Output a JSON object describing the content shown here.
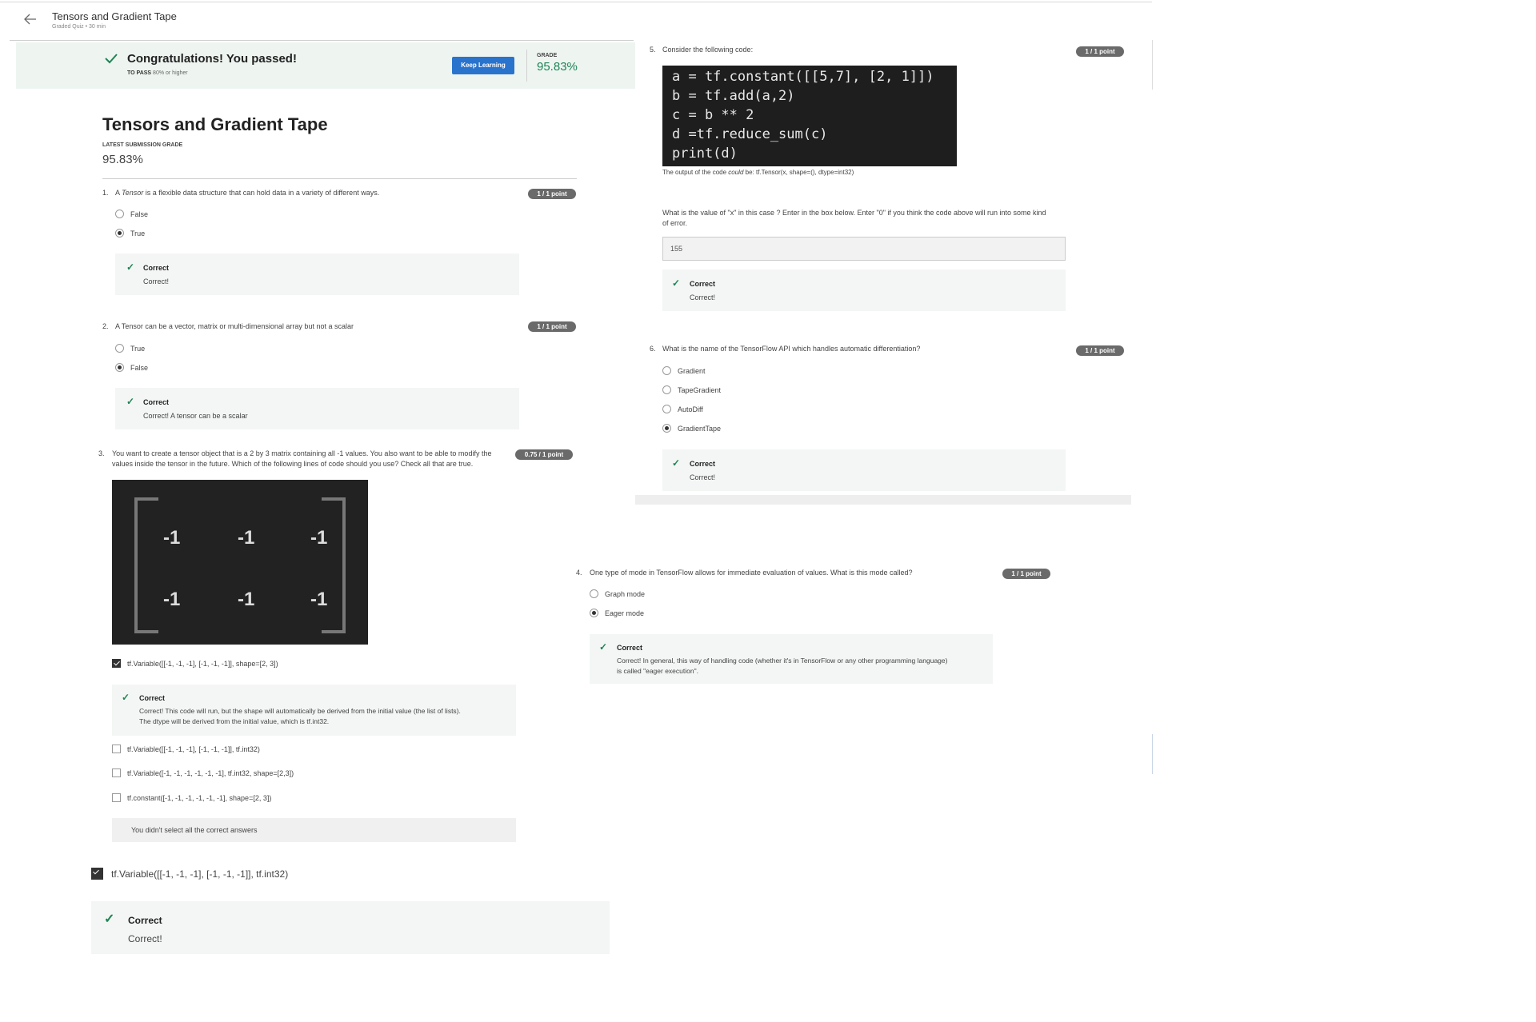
{
  "header": {
    "title": "Tensors and Gradient Tape",
    "subtitle": "Graded Quiz • 30 min"
  },
  "banner": {
    "message": "Congratulations! You passed!",
    "to_pass_label": "TO PASS",
    "to_pass_value": "80% or higher",
    "button": "Keep Learning",
    "grade_label": "GRADE",
    "grade_value": "95.83%"
  },
  "quiz": {
    "title": "Tensors and Gradient Tape",
    "latest_label": "LATEST SUBMISSION GRADE",
    "latest_value": "95.83%"
  },
  "q1": {
    "num": "1.",
    "text_pre": "A ",
    "text_em": "Tensor",
    "text_post": " is a flexible data structure that can hold data in a variety of different ways.",
    "points": "1 / 1 point",
    "options": [
      "False",
      "True"
    ],
    "fb_title": "Correct",
    "fb_text": "Correct!"
  },
  "q2": {
    "num": "2.",
    "text": "A Tensor can be a vector, matrix or multi-dimensional array but not a scalar",
    "points": "1 / 1 point",
    "options": [
      "True",
      "False"
    ],
    "fb_title": "Correct",
    "fb_text": "Correct! A tensor can be a scalar"
  },
  "q3": {
    "num": "3.",
    "text1": "You want to create a tensor object that is a 2 by 3 matrix containing all -1 values. You also want to be able to modify the",
    "text2": "values inside the tensor in the future. Which of the following lines of code should you use? Check all that are true.",
    "points": "0.75 / 1 point",
    "matrix": [
      "-1",
      "-1",
      "-1",
      "-1",
      "-1",
      "-1"
    ],
    "opt1": "tf.Variable([[-1, -1, -1], [-1, -1, -1]], shape=[2, 3])",
    "fb_title": "Correct",
    "fb_text1": "Correct! This code will run, but the shape will automatically be derived from the initial value (the list of lists).",
    "fb_text2": "The dtype will be derived from the initial value, which is tf.int32.",
    "opt2": "tf.Variable([[-1, -1, -1], [-1, -1, -1]], tf.int32)",
    "opt3": "tf.Variable([-1, -1, -1, -1, -1, -1], tf.int32, shape=[2,3])",
    "opt4": "tf.constant([-1, -1, -1, -1, -1, -1], shape=[2, 3])",
    "notice": "You didn't select all the correct answers",
    "extra_opt": "tf.Variable([[-1, -1, -1], [-1, -1, -1]], tf.int32)",
    "extra_fb_title": "Correct",
    "extra_fb_text": "Correct!"
  },
  "q4": {
    "num": "4.",
    "text": "One type of mode in TensorFlow allows for immediate evaluation of values. What is this mode called?",
    "points": "1 / 1 point",
    "options": [
      "Graph mode",
      "Eager mode"
    ],
    "fb_title": "Correct",
    "fb_text1": "Correct! In general, this way of handling code (whether it's in TensorFlow or any other programming language)",
    "fb_text2": "is called \"eager execution\"."
  },
  "q5": {
    "num": "5.",
    "text": "Consider the following code:",
    "points": "1 / 1 point",
    "code": [
      "a = tf.constant([[5,7], [2, 1]])",
      "b = tf.add(a,2)",
      "c = b ** 2",
      "d =tf.reduce_sum(c)",
      "print(d)"
    ],
    "output_pre": "The output of the code ",
    "output_em": "could",
    "output_post": " be: tf.Tensor(x, shape=(), dtype=int32)",
    "question1": "What is the value of \"x\" in this case ? Enter in the box below. Enter \"0\" if you think the code above will run into some kind",
    "question2": "of error.",
    "answer": "155",
    "fb_title": "Correct",
    "fb_text": "Correct!"
  },
  "q6": {
    "num": "6.",
    "text": "What is the name of the TensorFlow API which handles automatic differentiation?",
    "points": "1 / 1 point",
    "options": [
      "Gradient",
      "TapeGradient",
      "AutoDiff",
      "GradientTape"
    ],
    "fb_title": "Correct",
    "fb_text": "Correct!"
  },
  "colors": {
    "accent": "#1f8354",
    "button": "#2a73cc",
    "pill": "#6a6a6a"
  },
  "icons": {
    "back": "arrow-left-icon",
    "check": "checkmark-icon"
  }
}
